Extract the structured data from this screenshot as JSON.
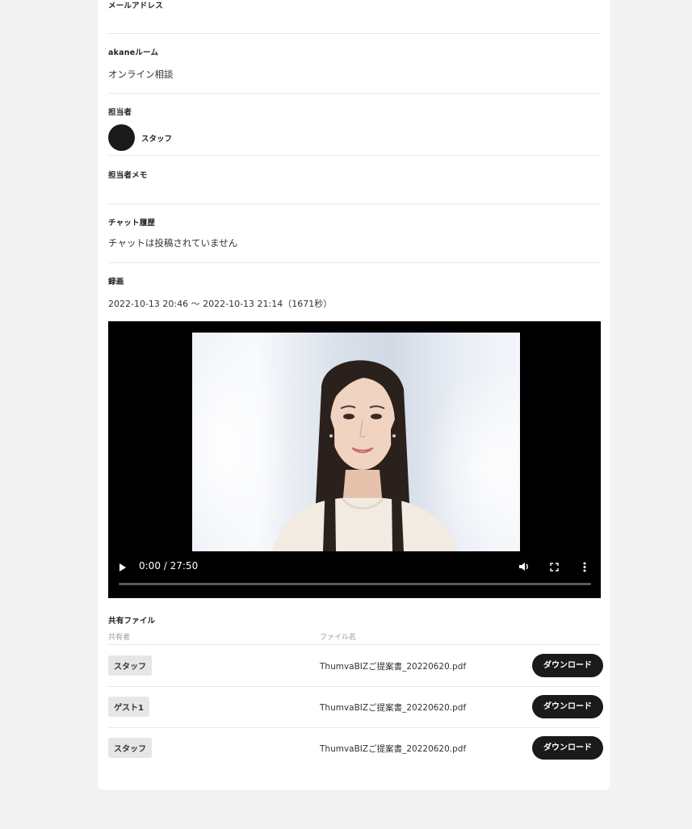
{
  "fields": {
    "email": {
      "label": "メールアドレス",
      "value": ""
    },
    "room": {
      "label": "akaneルーム",
      "value": "オンライン相談"
    },
    "assignee": {
      "label": "担当者",
      "name": "スタッフ"
    },
    "assignee_memo": {
      "label": "担当者メモ",
      "value": ""
    },
    "chat": {
      "label": "チャット履歴",
      "value": "チャットは投稿されていません"
    },
    "recording": {
      "label": "録画",
      "value": "2022-10-13 20:46 〜 2022-10-13 21:14（1671秒）"
    }
  },
  "video": {
    "time": "0:00 / 27:50",
    "progress": 0,
    "icons": [
      "play-icon",
      "volume-icon",
      "fullscreen-icon",
      "more-vert-icon"
    ]
  },
  "shared_files": {
    "title": "共有ファイル",
    "col_sharer": "共有者",
    "col_filename": "ファイル名",
    "rows": [
      {
        "sharer": "スタッフ",
        "filename": "ThumvaBIZご提案書_20220620.pdf",
        "button": "ダウンロード"
      },
      {
        "sharer": "ゲスト1",
        "filename": "ThumvaBIZご提案書_20220620.pdf",
        "button": "ダウンロード"
      },
      {
        "sharer": "スタッフ",
        "filename": "ThumvaBIZご提案書_20220620.pdf",
        "button": "ダウンロード"
      }
    ]
  },
  "colors": {
    "button_bg": "#1a1a1a",
    "chip_bg": "#e6e6e6",
    "page_bg": "#f3f3f3"
  }
}
